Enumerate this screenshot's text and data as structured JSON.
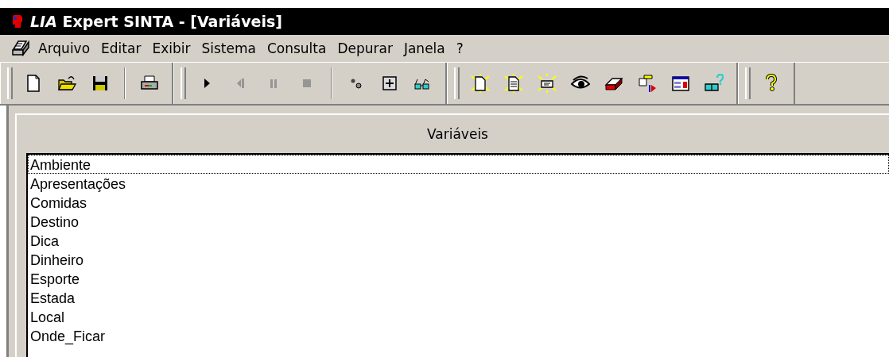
{
  "window": {
    "title": "*LIA* Expert SINTA - [Variáveis]"
  },
  "menu": [
    "Arquivo",
    "Editar",
    "Exibir",
    "Sistema",
    "Consulta",
    "Depurar",
    "Janela",
    "?"
  ],
  "toolbars": [
    {
      "groups": [
        [
          {
            "kind": "new",
            "disabled": false
          },
          {
            "kind": "open",
            "disabled": false
          },
          {
            "kind": "save",
            "disabled": false
          }
        ],
        [
          {
            "kind": "print",
            "disabled": false
          }
        ]
      ]
    },
    {
      "groups": [
        [
          {
            "kind": "play",
            "disabled": false
          },
          {
            "kind": "step-back",
            "disabled": true
          },
          {
            "kind": "pause",
            "disabled": true
          },
          {
            "kind": "stop",
            "disabled": true
          }
        ],
        [
          {
            "kind": "link",
            "disabled": false
          },
          {
            "kind": "plus",
            "disabled": false
          },
          {
            "kind": "glasses",
            "disabled": false
          }
        ]
      ]
    },
    {
      "groups": [
        [
          {
            "kind": "new-spark",
            "disabled": false
          },
          {
            "kind": "doc-spark",
            "disabled": false
          },
          {
            "kind": "card-spark",
            "disabled": false
          },
          {
            "kind": "eye",
            "disabled": false
          },
          {
            "kind": "box",
            "disabled": false
          },
          {
            "kind": "flow",
            "disabled": false
          },
          {
            "kind": "window",
            "disabled": false
          },
          {
            "kind": "book-help",
            "disabled": false
          }
        ]
      ]
    },
    {
      "groups": [
        [
          {
            "kind": "help",
            "disabled": false
          }
        ]
      ]
    }
  ],
  "child_window": {
    "header": "Variáveis",
    "items": [
      {
        "label": "Ambiente",
        "focused": true
      },
      {
        "label": "Apresentações",
        "focused": false
      },
      {
        "label": "Comidas",
        "focused": false
      },
      {
        "label": "Destino",
        "focused": false
      },
      {
        "label": "Dica",
        "focused": false
      },
      {
        "label": "Dinheiro",
        "focused": false
      },
      {
        "label": "Esporte",
        "focused": false
      },
      {
        "label": "Estada",
        "focused": false
      },
      {
        "label": "Local",
        "focused": false
      },
      {
        "label": "Onde_Ficar",
        "focused": false
      }
    ]
  }
}
